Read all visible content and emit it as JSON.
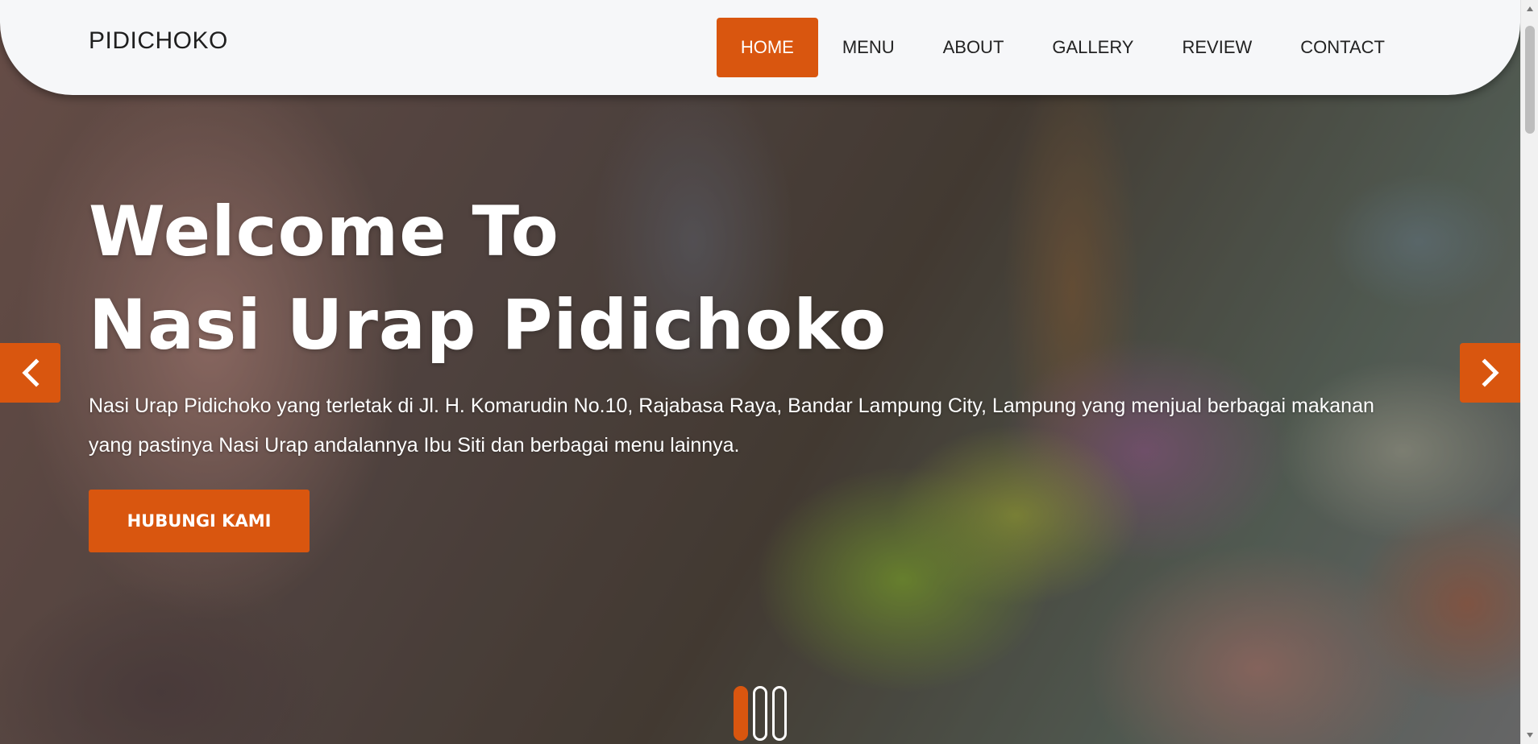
{
  "navbar": {
    "brand": "PIDICHOKO",
    "items": [
      {
        "label": "HOME",
        "active": true
      },
      {
        "label": "MENU",
        "active": false
      },
      {
        "label": "ABOUT",
        "active": false
      },
      {
        "label": "GALLERY",
        "active": false
      },
      {
        "label": "REVIEW",
        "active": false
      },
      {
        "label": "CONTACT",
        "active": false
      }
    ]
  },
  "hero": {
    "title_line1": "Welcome To",
    "title_line2": "Nasi Urap Pidichoko",
    "description": "Nasi Urap Pidichoko yang terletak di Jl. H. Komarudin No.10, Rajabasa Raya, Bandar Lampung City, Lampung yang menjual berbagai makanan yang pastinya Nasi Urap andalannya Ibu Siti dan berbagai menu lainnya.",
    "cta_label": "HUBUNGI KAMI"
  },
  "carousel": {
    "prev_icon": "chevron-left-icon",
    "next_icon": "chevron-right-icon",
    "slide_count": 3,
    "active_index": 0
  },
  "colors": {
    "accent": "#d9560f",
    "navbar_bg": "#f6f7f9",
    "text_light": "#ffffff"
  }
}
